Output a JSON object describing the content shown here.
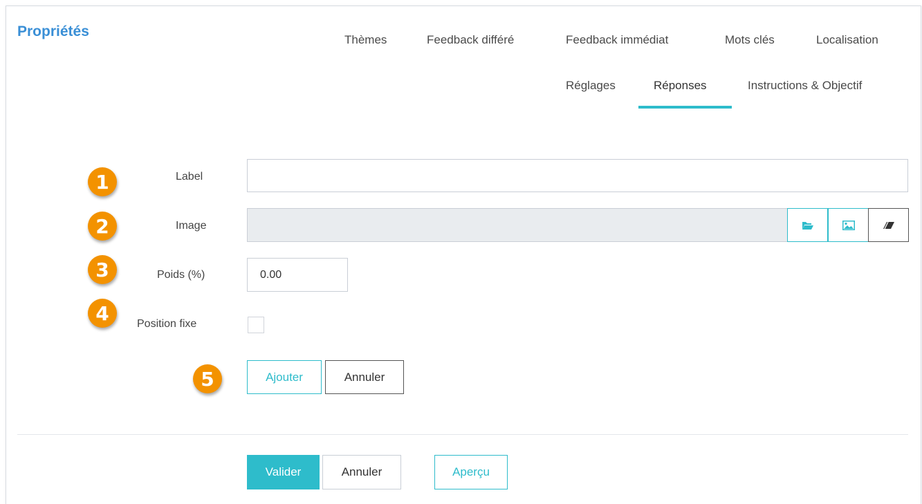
{
  "panel": {
    "title": "Propriétés"
  },
  "tabs": [
    {
      "label": "Thèmes"
    },
    {
      "label": "Feedback différé"
    },
    {
      "label": "Feedback immédiat"
    },
    {
      "label": "Mots clés"
    },
    {
      "label": "Localisation"
    },
    {
      "label": "Réglages"
    },
    {
      "label": "Réponses",
      "active": true
    },
    {
      "label": "Instructions & Objectif"
    }
  ],
  "form": {
    "label": {
      "badge": "1",
      "label": "Label",
      "value": ""
    },
    "image": {
      "badge": "2",
      "label": "Image",
      "value": ""
    },
    "weight": {
      "badge": "3",
      "label": "Poids (%)",
      "value": "0.00"
    },
    "fixed_position": {
      "badge": "4",
      "label": "Position fixe",
      "checked": false
    },
    "actions": {
      "badge": "5",
      "add_label": "Ajouter",
      "cancel_label": "Annuler"
    }
  },
  "footer": {
    "validate_label": "Valider",
    "cancel_label": "Annuler",
    "preview_label": "Aperçu"
  },
  "colors": {
    "accent": "#2ebccb",
    "title": "#3a8fd6",
    "badge": "#f39200"
  },
  "icons": [
    "folder-open-icon",
    "picture-icon",
    "eraser-icon"
  ]
}
